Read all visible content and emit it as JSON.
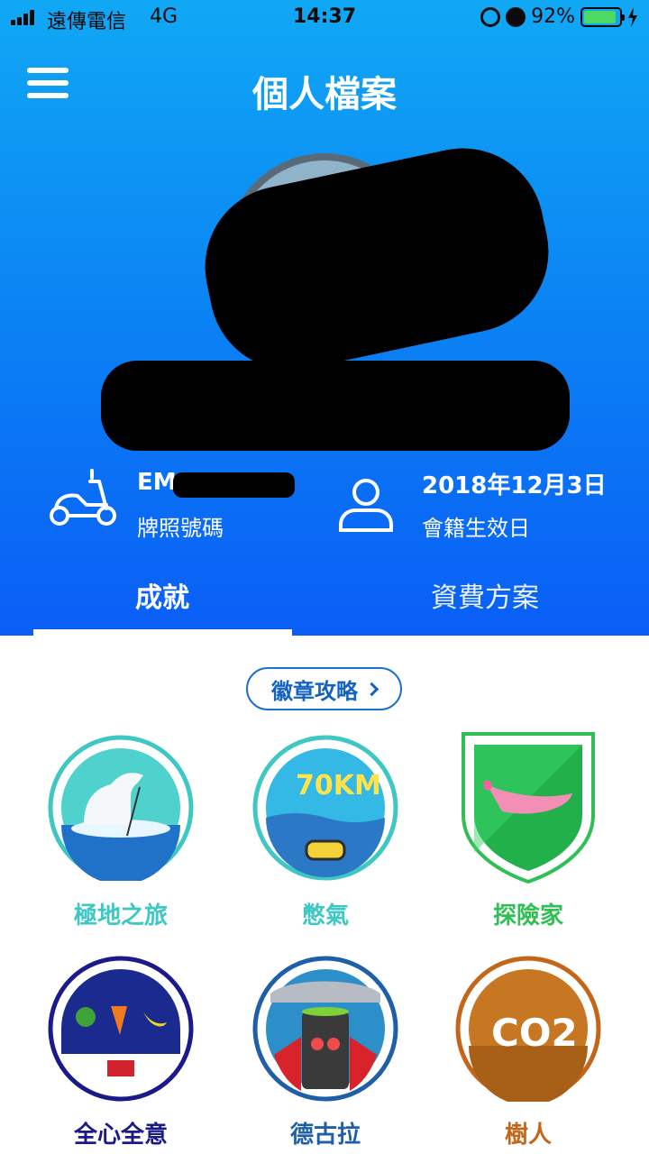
{
  "status_bar": {
    "carrier": "遠傳電信",
    "network": "4G",
    "time": "14:37",
    "battery": "92%",
    "battery_level": 0.92
  },
  "header": {
    "title": "個人檔案",
    "menu_icon": "hamburger-menu-icon"
  },
  "profile": {
    "plate_value": "EM",
    "plate_label": "牌照號碼",
    "member_date": "2018年12月3日",
    "member_label": "會籍生效日"
  },
  "tabs": [
    {
      "label": "成就",
      "active": true
    },
    {
      "label": "資費方案",
      "active": false
    }
  ],
  "guide_button": {
    "label": "徽章攻略"
  },
  "badges": [
    {
      "label": "極地之旅",
      "color": "#3fc7c3"
    },
    {
      "label": "憋氣",
      "color": "#3fc7c3",
      "art_text": "70KM"
    },
    {
      "label": "探險家",
      "color": "#2fbf55"
    },
    {
      "label": "全心全意",
      "color": "#1a1a8a"
    },
    {
      "label": "德古拉",
      "color": "#1f5fa8"
    },
    {
      "label": "樹人",
      "color": "#c4661a",
      "art_text": "CO2"
    }
  ],
  "colors": {
    "hero_top": "#10a8f5",
    "hero_bottom": "#0a5ef6",
    "accent": "#1462c4"
  }
}
